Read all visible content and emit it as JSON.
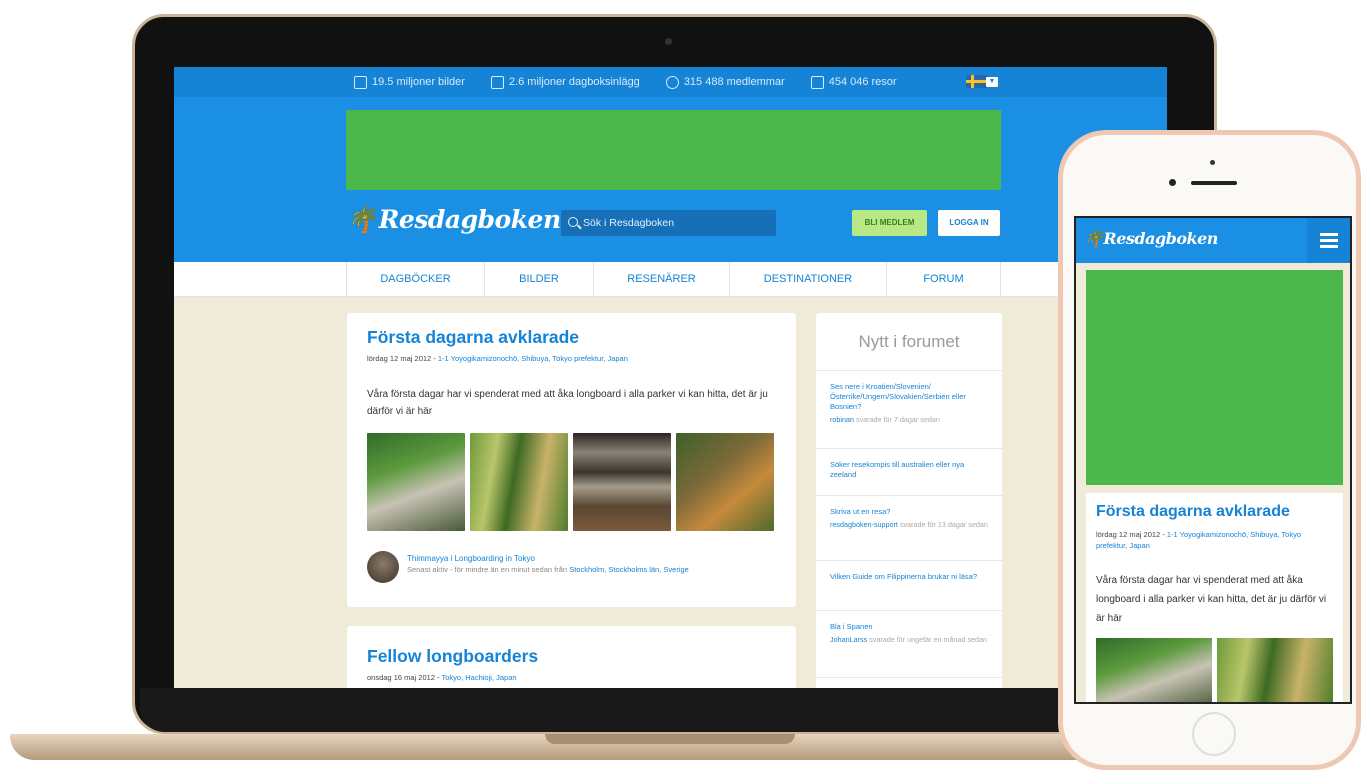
{
  "stats": [
    {
      "icon": "camera-icon",
      "label": "19.5 miljoner bilder"
    },
    {
      "icon": "document-icon",
      "label": "2.6 miljoner dagboksinlägg"
    },
    {
      "icon": "user-icon",
      "label": "315 488 medlemmar"
    },
    {
      "icon": "map-icon",
      "label": "454 046 resor"
    }
  ],
  "brand": {
    "name": "Resdagboken",
    "palm_glyph": "🌴",
    "accent": "#1a8fe3",
    "ad_color": "#4cb84c"
  },
  "search": {
    "placeholder": "Sök i Resdagboken"
  },
  "header": {
    "join_label": "BLI MEDLEM",
    "login_label": "LOGGA IN"
  },
  "nav": [
    "DAGBÖCKER",
    "BILDER",
    "RESENÄRER",
    "DESTINATIONER",
    "FORUM"
  ],
  "posts": [
    {
      "title": "Första dagarna avklarade",
      "date": "lördag 12 maj 2012",
      "location": "1-1 Yoyogikamizonochō, Shibuya, Tokyo prefektur, Japan",
      "text": "Våra första dagar har vi spenderat med att åka longboard i alla parker vi kan hitta, det är ju därför vi är här",
      "author": "Thimmayya i Longboarding in Tokyo",
      "activity": "Senast aktiv - för mindre än en minut sedan från",
      "author_location": "Stockholm, Stockholms län, Sverige"
    },
    {
      "title": "Fellow longboarders",
      "date": "onsdag 16 maj 2012",
      "location": "Tokyo, Hachioji, Japan"
    }
  ],
  "forum": {
    "title": "Nytt i forumet",
    "items": [
      {
        "question": "Ses nere i Kroatien/Slovenien/ Österrike/Ungern/Slovakien/Serbien eller Bosnien?",
        "user": "robinan",
        "when": "svarade för 7 dagar sedan"
      },
      {
        "question": "Söker resekompis till australien eller nya zeeland",
        "user": "",
        "when": ""
      },
      {
        "question": "Skriva ut en resa?",
        "user": "resdagboken-support",
        "when": "svarade för 13 dagar sedan"
      },
      {
        "question": "Vilken Guide om Filippinerna brukar ni läsa?",
        "user": "",
        "when": ""
      },
      {
        "question": "Bla i Spanen",
        "user": "JohanLarss",
        "when": "svarade för ungefär en månad sedan"
      }
    ]
  },
  "phone": {
    "logo": "Resdagboken",
    "post_title": "Första dagarna avklarade",
    "post_date": "lördag 12 maj 2012",
    "post_location": "1-1 Yoyogikamizonochō, Shibuya, Tokyo prefektur, Japan",
    "post_text": "Våra första dagar har vi spenderat med att åka longboard i alla parker vi kan hitta, det är ju därför vi är här"
  }
}
